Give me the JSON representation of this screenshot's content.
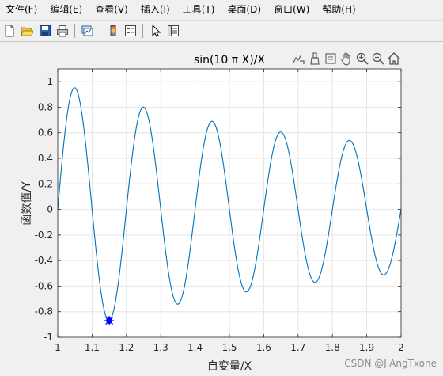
{
  "menubar": {
    "items": [
      {
        "label": "文件(F)"
      },
      {
        "label": "编辑(E)"
      },
      {
        "label": "查看(V)"
      },
      {
        "label": "插入(I)"
      },
      {
        "label": "工具(T)"
      },
      {
        "label": "桌面(D)"
      },
      {
        "label": "窗口(W)"
      },
      {
        "label": "帮助(H)"
      }
    ]
  },
  "toolbar": {
    "buttons": [
      "new-figure-icon",
      "open-file-icon",
      "save-icon",
      "print-icon",
      "link-plot-icon",
      "colorbar-icon",
      "legend-icon",
      "pointer-icon",
      "property-inspector-icon"
    ]
  },
  "axes_toolbar": {
    "buttons": [
      "export-icon",
      "brush-icon",
      "data-tip-icon",
      "pan-icon",
      "zoom-in-icon",
      "zoom-out-icon",
      "home-icon"
    ]
  },
  "chart_data": {
    "type": "line",
    "title": "sin(10 π X)/X",
    "xlabel": "自变量/X",
    "ylabel": "函数值/Y",
    "xlim": [
      1,
      2
    ],
    "ylim": [
      -1,
      1.1
    ],
    "xticks": [
      1,
      1.1,
      1.2,
      1.3,
      1.4,
      1.5,
      1.6,
      1.7,
      1.8,
      1.9,
      2
    ],
    "xtick_labels": [
      "1",
      "1.1",
      "1.2",
      "1.3",
      "1.4",
      "1.5",
      "1.6",
      "1.7",
      "1.8",
      "1.9",
      "2"
    ],
    "yticks": [
      -1,
      -0.8,
      -0.6,
      -0.4,
      -0.2,
      0,
      0.2,
      0.4,
      0.6,
      0.8,
      1
    ],
    "ytick_labels": [
      "-1",
      "-0.8",
      "-0.6",
      "-0.4",
      "-0.2",
      "0",
      "0.2",
      "0.4",
      "0.6",
      "0.8",
      "1"
    ],
    "grid": true,
    "line_color": "#0072bd",
    "function": "sin(10*pi*x)/x",
    "marker": {
      "x": 1.15,
      "y": -0.87,
      "color": "#0000ff"
    }
  },
  "watermark": "CSDN @JiAngTxone"
}
